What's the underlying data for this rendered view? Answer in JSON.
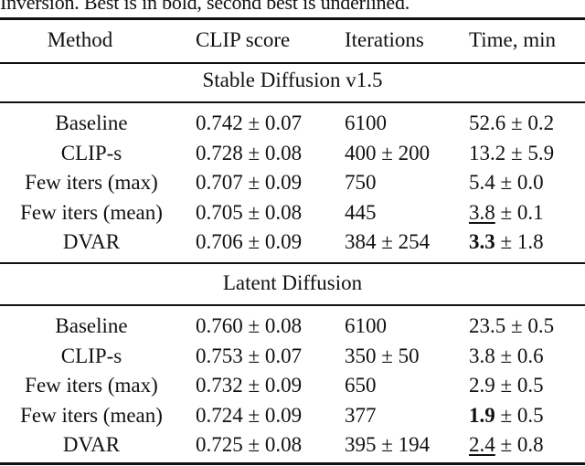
{
  "caption": "Inversion. Best is in bold, second best is underlined.",
  "table": {
    "headers": [
      "Method",
      "CLIP score",
      "Iterations",
      "Time, min"
    ],
    "sections": [
      {
        "title": "Stable Diffusion v1.5",
        "rows": [
          {
            "method": "Baseline",
            "clip": "0.742 ± 0.07",
            "iterations": "6100",
            "time_main": "52.6",
            "time_rest": " ± 0.2",
            "time_style": "normal"
          },
          {
            "method": "CLIP-s",
            "clip": "0.728 ± 0.08",
            "iterations": "400 ± 200",
            "time_main": "13.2",
            "time_rest": " ± 5.9",
            "time_style": "normal"
          },
          {
            "method": "Few iters (max)",
            "clip": "0.707 ± 0.09",
            "iterations": "750",
            "time_main": "5.4",
            "time_rest": " ± 0.0",
            "time_style": "normal"
          },
          {
            "method": "Few iters (mean)",
            "clip": "0.705 ± 0.08",
            "iterations": "445",
            "time_main": "3.8",
            "time_rest": " ± 0.1",
            "time_style": "underline"
          },
          {
            "method": "DVAR",
            "clip": "0.706 ± 0.09",
            "iterations": "384 ± 254",
            "time_main": "3.3",
            "time_rest": " ± 1.8",
            "time_style": "bold"
          }
        ]
      },
      {
        "title": "Latent Diffusion",
        "rows": [
          {
            "method": "Baseline",
            "clip": "0.760 ± 0.08",
            "iterations": "6100",
            "time_main": "23.5",
            "time_rest": " ± 0.5",
            "time_style": "normal"
          },
          {
            "method": "CLIP-s",
            "clip": "0.753 ± 0.07",
            "iterations": "350 ± 50",
            "time_main": "3.8",
            "time_rest": " ± 0.6",
            "time_style": "normal"
          },
          {
            "method": "Few iters (max)",
            "clip": "0.732 ± 0.09",
            "iterations": "650",
            "time_main": "2.9",
            "time_rest": " ± 0.5",
            "time_style": "normal"
          },
          {
            "method": "Few iters (mean)",
            "clip": "0.724 ± 0.09",
            "iterations": "377",
            "time_main": "1.9",
            "time_rest": " ± 0.5",
            "time_style": "bold"
          },
          {
            "method": "DVAR",
            "clip": "0.725 ± 0.08",
            "iterations": "395 ± 194",
            "time_main": "2.4",
            "time_rest": " ± 0.8",
            "time_style": "underline"
          }
        ]
      }
    ]
  }
}
